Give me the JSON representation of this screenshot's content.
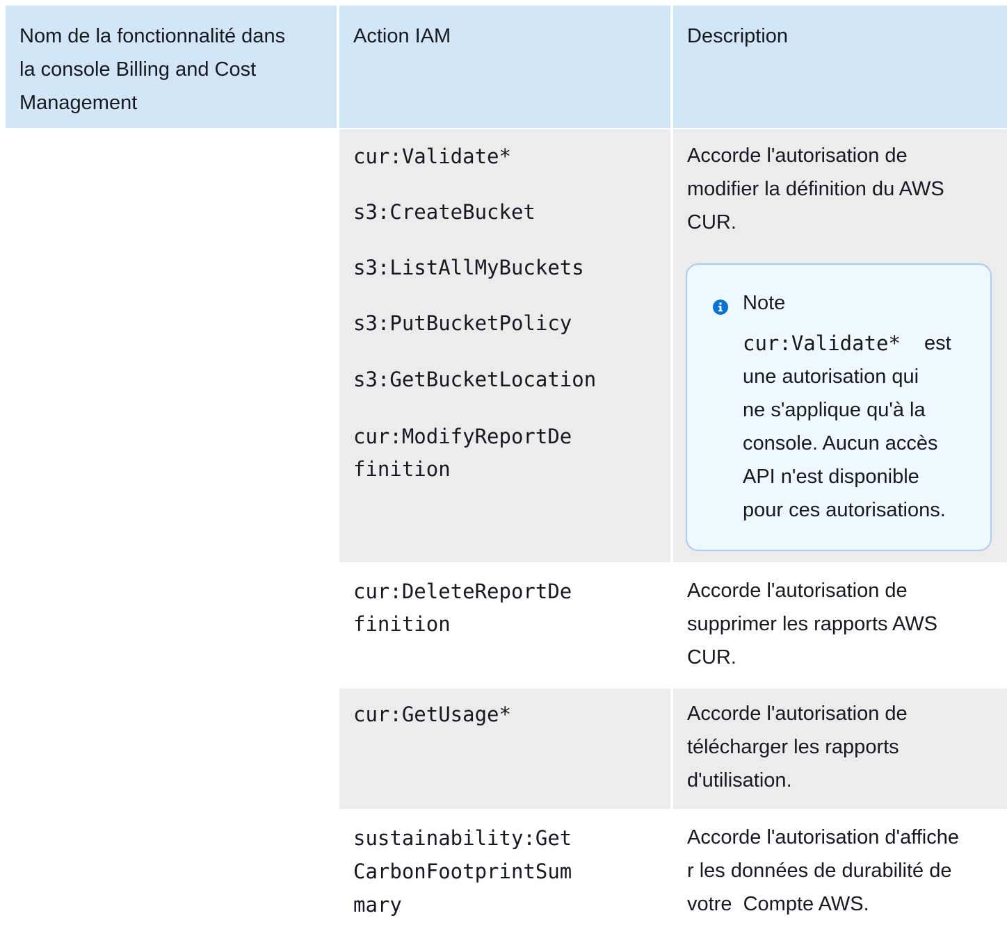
{
  "header": {
    "col1_lines": [
      "Nom de la fonctionnalité dans",
      "la console Billing and Cost",
      "Management"
    ],
    "col2": "Action IAM",
    "col3": "Description"
  },
  "rows": [
    {
      "actions": [
        "cur:Validate*",
        "s3:CreateBucket",
        "s3:ListAllMyBuckets",
        "s3:PutBucketPolicy",
        "s3:GetBucketLocation",
        "cur:ModifyReportDe",
        "finition"
      ],
      "description_lines": [
        "Accorde l'autorisation de",
        "modifier la définition du AWS",
        "CUR."
      ],
      "note": {
        "title": "Note",
        "code": "cur:Validate*",
        "text_lines": [
          "est",
          "une autorisation qui",
          "ne s'applique qu'à la",
          "console. Aucun accès",
          "API n'est disponible",
          "pour ces autorisations."
        ]
      }
    },
    {
      "actions": [
        "cur:DeleteReportDe",
        "finition"
      ],
      "description_lines": [
        "Accorde l'autorisation de",
        "supprimer les rapports AWS",
        "CUR."
      ]
    },
    {
      "actions": [
        "cur:GetUsage*"
      ],
      "description_lines": [
        "Accorde l'autorisation de",
        "télécharger les rapports",
        "d'utilisation."
      ]
    },
    {
      "actions": [
        "sustainability:Get",
        "CarbonFootprintSum",
        "mary"
      ],
      "description_lines": [
        "Accorde l'autorisation d'affiche",
        "r les données de durabilité de",
        "votre  Compte AWS."
      ]
    }
  ],
  "colors": {
    "header_bg": "#d3e6f7",
    "row_gray": "#ececec",
    "note_border": "#a8cdf0",
    "note_bg": "#f0f8ff",
    "info_icon": "#0972d3"
  }
}
